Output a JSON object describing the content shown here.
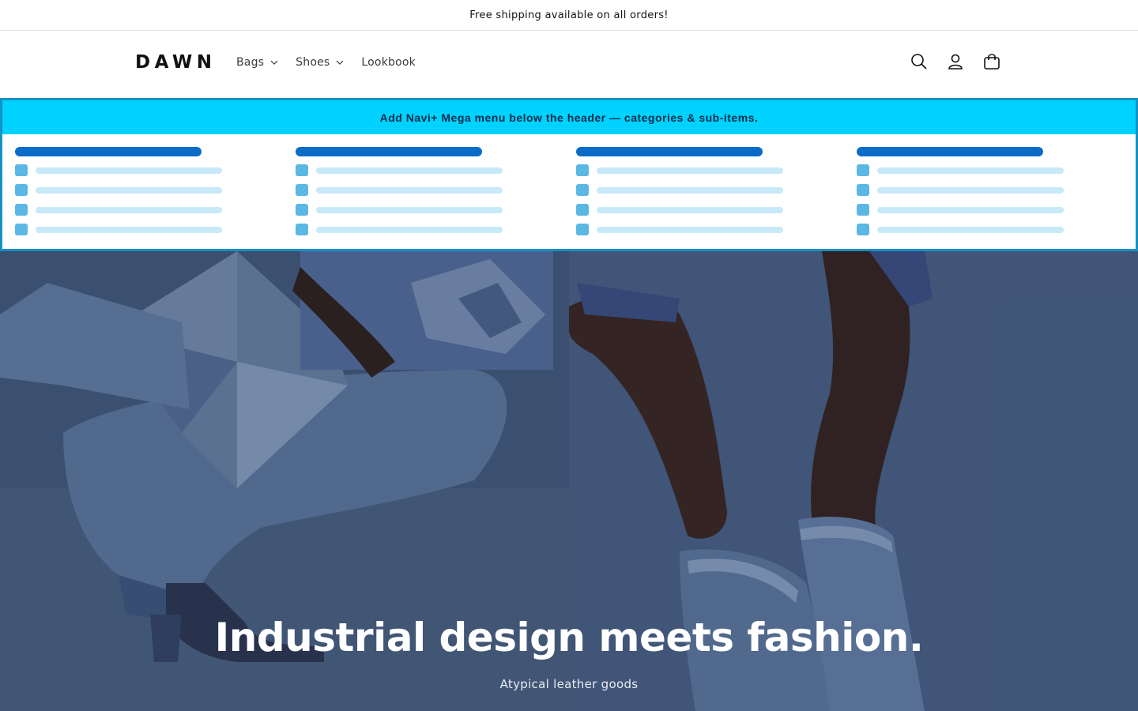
{
  "announcement": {
    "text": "Free shipping available on all orders!"
  },
  "header": {
    "logo": "DAWN",
    "nav": [
      {
        "label": "Bags",
        "has_dropdown": true
      },
      {
        "label": "Shoes",
        "has_dropdown": true
      },
      {
        "label": "Lookbook",
        "has_dropdown": false
      }
    ],
    "icons": [
      "search-icon",
      "account-icon",
      "cart-icon"
    ]
  },
  "mega_menu": {
    "banner_text": "Add Navi+ Mega menu below the header — categories & sub-items.",
    "columns": 4,
    "sub_items_per_column": 4,
    "colors": {
      "border": "#1591c4",
      "banner_bg": "#00d2ff",
      "category_bar": "#0b6cc7",
      "item_square": "#5bb7e3",
      "item_line": "#c8e9f8"
    }
  },
  "hero": {
    "title": "Industrial design meets fashion.",
    "subtitle": "Atypical leather goods"
  }
}
